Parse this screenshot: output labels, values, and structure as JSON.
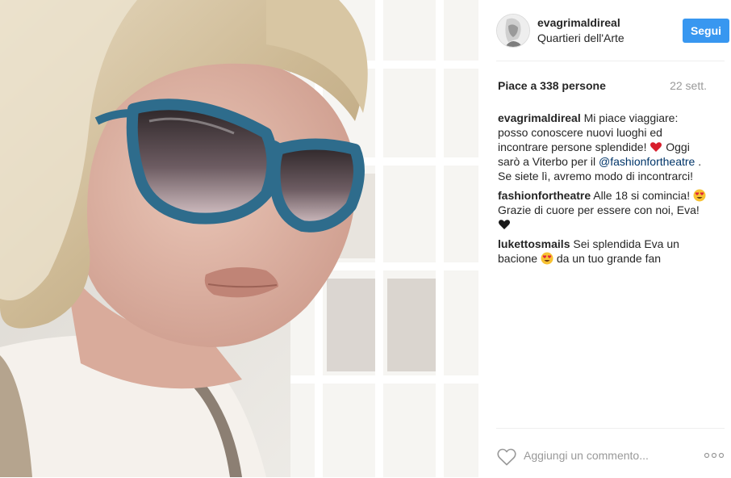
{
  "post": {
    "username": "evagrimaldireal",
    "location": "Quartieri dell'Arte",
    "follow_label": "Segui",
    "likes": "Piace a 338 persone",
    "date": "22 sett."
  },
  "comments": [
    {
      "user": "evagrimaldireal",
      "text_1": "Mi piace viaggiare: posso conoscere nuovi luoghi ed incontrare persone splendide!",
      "emoji_1": "red-heart-emoji",
      "text_2": "Oggi sarò a Viterbo per il",
      "mention": "@fashionfortheatre",
      "text_3": ". Se siete lì, avremo modo di incontrarci!"
    },
    {
      "user": "fashionfortheatre",
      "text_1": "Alle 18 si comincia!",
      "emoji_1": "heart-eyes-emoji",
      "text_2": "Grazie di cuore per essere con noi, Eva!",
      "emoji_2": "black-heart-emoji"
    },
    {
      "user": "lukettosmails",
      "text_1": "Sei splendida Eva un bacione",
      "emoji_1": "heart-eyes-emoji",
      "text_2": "da un tuo grande fan"
    }
  ],
  "footer": {
    "comment_placeholder": "Aggiungi un commento...",
    "like_icon": "heart-outline-icon",
    "more_icon": "more-options-icon"
  },
  "colors": {
    "follow_button": "#3897f0",
    "mention": "#003569",
    "muted": "#999999",
    "text": "#262626"
  }
}
